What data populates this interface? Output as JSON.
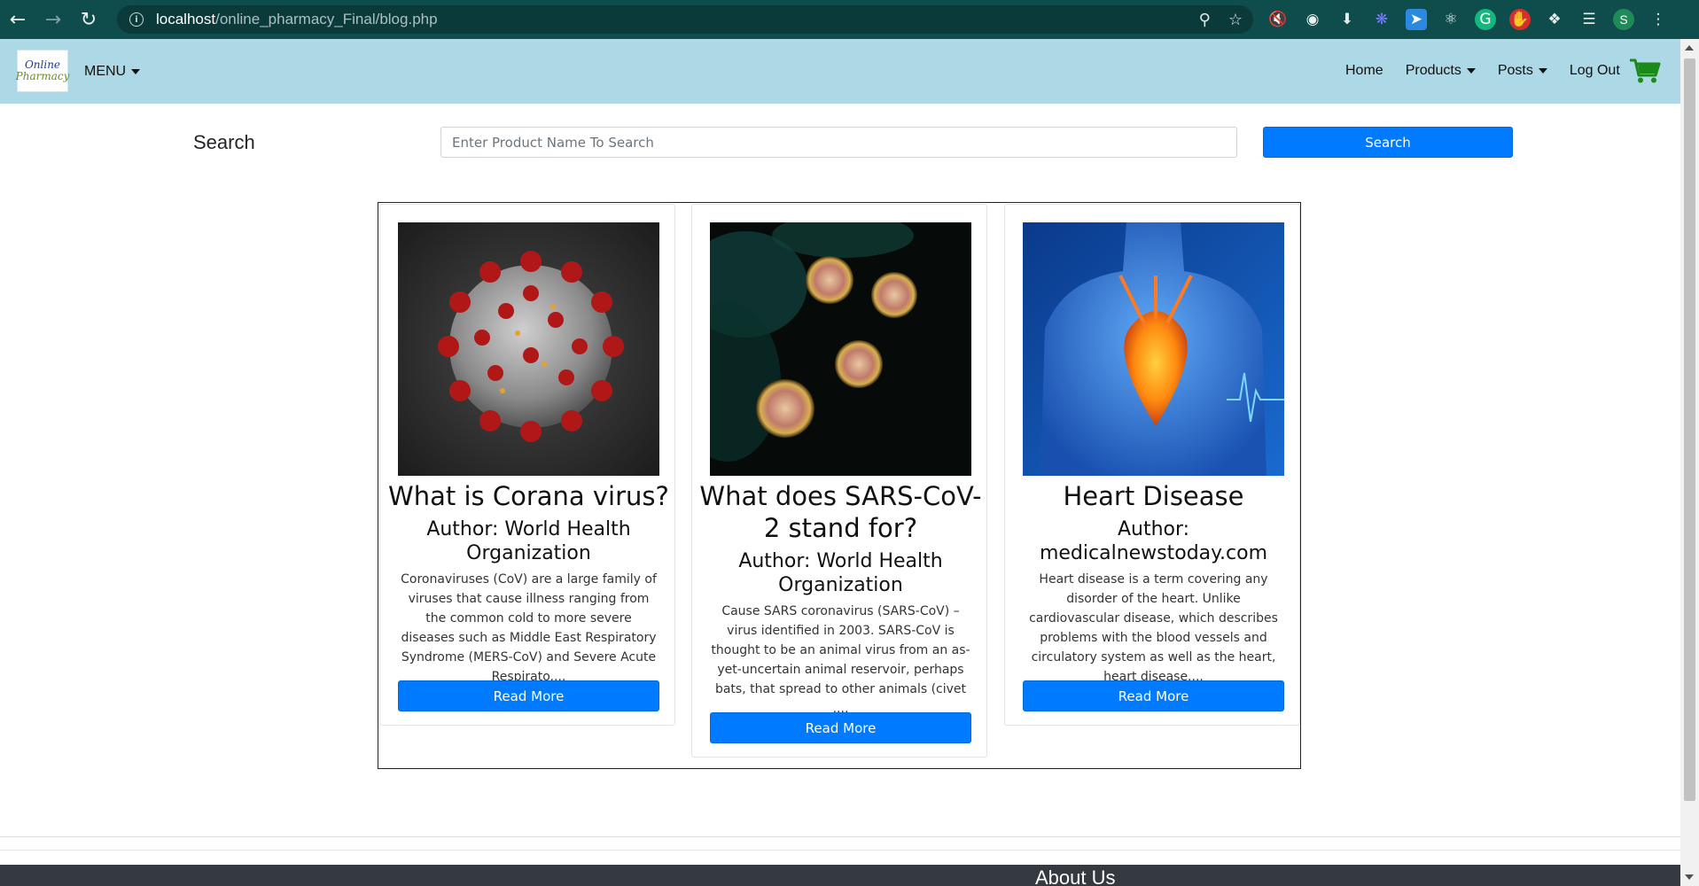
{
  "browser": {
    "url_host": "localhost",
    "url_path": "/online_pharmacy_Final/blog.php",
    "profile_initial": "S"
  },
  "site": {
    "logo_line1": "Online",
    "logo_line2": "Pharmacy",
    "menu_label": "MENU",
    "nav": {
      "home": "Home",
      "products": "Products",
      "posts": "Posts",
      "logout": "Log Out"
    }
  },
  "search": {
    "label": "Search",
    "placeholder": "Enter Product Name To Search",
    "button": "Search"
  },
  "posts": [
    {
      "title": "What is Corana virus?",
      "author": "Author: World Health Organization",
      "excerpt": "Coronaviruses (CoV) are a large family of viruses that cause illness ranging from the common cold to more severe diseases such as Middle East Respiratory Syndrome (MERS-CoV) and Severe Acute Respirato....",
      "button": "Read More"
    },
    {
      "title": "What does SARS-CoV-2 stand for?",
      "author": "Author: World Health Organization",
      "excerpt": "Cause SARS coronavirus (SARS-CoV) – virus identified in 2003. SARS-CoV is thought to be an animal virus from an as-yet-uncertain animal reservoir, perhaps bats, that spread to other animals (civet ....",
      "button": "Read More"
    },
    {
      "title": "Heart Disease",
      "author": "Author: medicalnewstoday.com",
      "excerpt": "Heart disease is a term covering any disorder of the heart. Unlike cardiovascular disease, which describes problems with the blood vessels and circulatory system as well as the heart, heart disease....",
      "button": "Read More"
    }
  ],
  "footer": {
    "about": "About Us"
  },
  "colors": {
    "navbar_bg": "#add8e6",
    "primary": "#007bff",
    "cart": "#1a8a1a",
    "footer_bg": "#343a40"
  }
}
